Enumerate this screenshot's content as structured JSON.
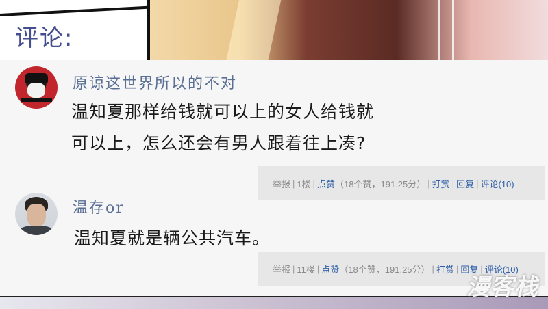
{
  "section": {
    "title": "评论:"
  },
  "comments": [
    {
      "username": "原谅这世界所以的不对",
      "text_lines": [
        "温知夏那样给钱就可以上的女人给钱就",
        "可以上，怎么还会有男人跟着往上凑?"
      ],
      "actions": {
        "report": "举报",
        "floor": "1楼",
        "like": "点赞",
        "like_stats": "（18个赞，191.25分）",
        "tip": "打赏",
        "reply": "回复",
        "comments": "评论(10)"
      }
    },
    {
      "username": "温存or",
      "text_lines": [
        "温知夏就是辆公共汽车。"
      ],
      "actions": {
        "report": "举报",
        "floor": "11楼",
        "like": "点赞",
        "like_stats": "（18个赞，191.25分）",
        "tip": "打赏",
        "reply": "回复",
        "comments": "评论(10)"
      }
    }
  ],
  "watermark": {
    "text": "漫客栈"
  }
}
